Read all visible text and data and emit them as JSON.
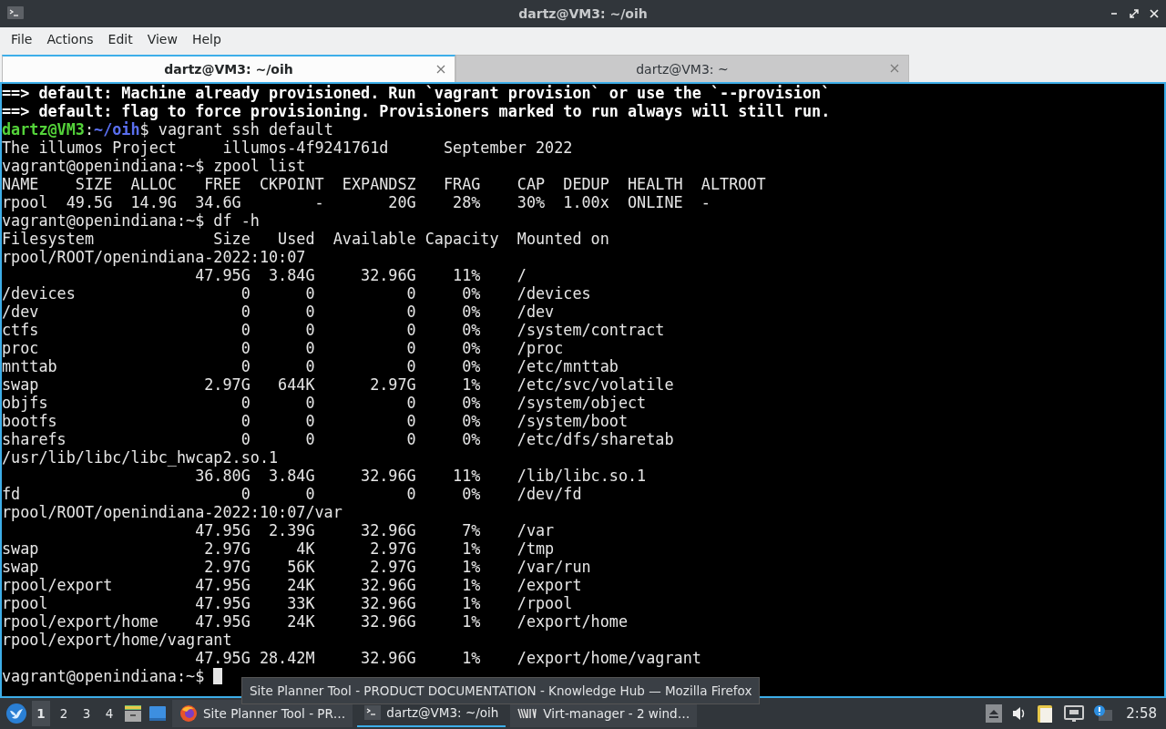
{
  "window": {
    "title": "dartz@VM3: ~/oih"
  },
  "menu": [
    "File",
    "Actions",
    "Edit",
    "View",
    "Help"
  ],
  "tabs": [
    {
      "label": "dartz@VM3: ~/oih",
      "selected": true
    },
    {
      "label": "dartz@VM3: ~",
      "selected": false
    }
  ],
  "terminal": {
    "lines": [
      {
        "kind": "notice",
        "text": "==> default: Machine already provisioned. Run `vagrant provision` or use the `--provision`"
      },
      {
        "kind": "notice",
        "text": "==> default: flag to force provisioning. Provisioners marked to run always will still run."
      },
      {
        "kind": "host_prompt",
        "user": "dartz@VM3",
        "sep": ":",
        "path": "~/oih",
        "command": "$ vagrant ssh default"
      },
      {
        "kind": "output",
        "text": "The illumos Project     illumos-4f9241761d      September 2022"
      },
      {
        "kind": "output",
        "text": "vagrant@openindiana:~$ zpool list"
      },
      {
        "kind": "output",
        "text": "NAME    SIZE  ALLOC   FREE  CKPOINT  EXPANDSZ   FRAG    CAP  DEDUP  HEALTH  ALTROOT"
      },
      {
        "kind": "output",
        "text": "rpool  49.5G  14.9G  34.6G        -       20G    28%    30%  1.00x  ONLINE  -"
      },
      {
        "kind": "output",
        "text": "vagrant@openindiana:~$ df -h"
      },
      {
        "kind": "output",
        "text": "Filesystem             Size   Used  Available Capacity  Mounted on"
      },
      {
        "kind": "output",
        "text": "rpool/ROOT/openindiana-2022:10:07"
      },
      {
        "kind": "output",
        "text": "                     47.95G  3.84G     32.96G    11%    /"
      },
      {
        "kind": "output",
        "text": "/devices                  0      0          0     0%    /devices"
      },
      {
        "kind": "output",
        "text": "/dev                      0      0          0     0%    /dev"
      },
      {
        "kind": "output",
        "text": "ctfs                      0      0          0     0%    /system/contract"
      },
      {
        "kind": "output",
        "text": "proc                      0      0          0     0%    /proc"
      },
      {
        "kind": "output",
        "text": "mnttab                    0      0          0     0%    /etc/mnttab"
      },
      {
        "kind": "output",
        "text": "swap                  2.97G   644K      2.97G     1%    /etc/svc/volatile"
      },
      {
        "kind": "output",
        "text": "objfs                     0      0          0     0%    /system/object"
      },
      {
        "kind": "output",
        "text": "bootfs                    0      0          0     0%    /system/boot"
      },
      {
        "kind": "output",
        "text": "sharefs                   0      0          0     0%    /etc/dfs/sharetab"
      },
      {
        "kind": "output",
        "text": "/usr/lib/libc/libc_hwcap2.so.1"
      },
      {
        "kind": "output",
        "text": "                     36.80G  3.84G     32.96G    11%    /lib/libc.so.1"
      },
      {
        "kind": "output",
        "text": "fd                        0      0          0     0%    /dev/fd"
      },
      {
        "kind": "output",
        "text": "rpool/ROOT/openindiana-2022:10:07/var"
      },
      {
        "kind": "output",
        "text": "                     47.95G  2.39G     32.96G     7%    /var"
      },
      {
        "kind": "output",
        "text": "swap                  2.97G     4K      2.97G     1%    /tmp"
      },
      {
        "kind": "output",
        "text": "swap                  2.97G    56K      2.97G     1%    /var/run"
      },
      {
        "kind": "output",
        "text": "rpool/export         47.95G    24K     32.96G     1%    /export"
      },
      {
        "kind": "output",
        "text": "rpool                47.95G    33K     32.96G     1%    /rpool"
      },
      {
        "kind": "output",
        "text": "rpool/export/home    47.95G    24K     32.96G     1%    /export/home"
      },
      {
        "kind": "output",
        "text": "rpool/export/home/vagrant"
      },
      {
        "kind": "output",
        "text": "                     47.95G 28.42M     32.96G     1%    /export/home/vagrant"
      }
    ],
    "prompt": {
      "text": "vagrant@openindiana:~$ ",
      "cursor": true
    }
  },
  "tooltip": "Site Planner Tool - PRODUCT DOCUMENTATION - Knowledge Hub — Mozilla Firefox",
  "taskbar": {
    "desktops": [
      {
        "label": "1",
        "selected": true
      },
      {
        "label": "2",
        "selected": false
      },
      {
        "label": "3",
        "selected": false
      },
      {
        "label": "4",
        "selected": false
      }
    ],
    "tasks": [
      {
        "kind": "browser",
        "label": "Site Planner Tool - PR…",
        "selected": false
      },
      {
        "kind": "terminal",
        "label": "dartz@VM3: ~/oih",
        "selected": true
      },
      {
        "kind": "virt",
        "label": "Virt-manager - 2 wind…",
        "selected": false
      }
    ],
    "clock": "2:58"
  }
}
